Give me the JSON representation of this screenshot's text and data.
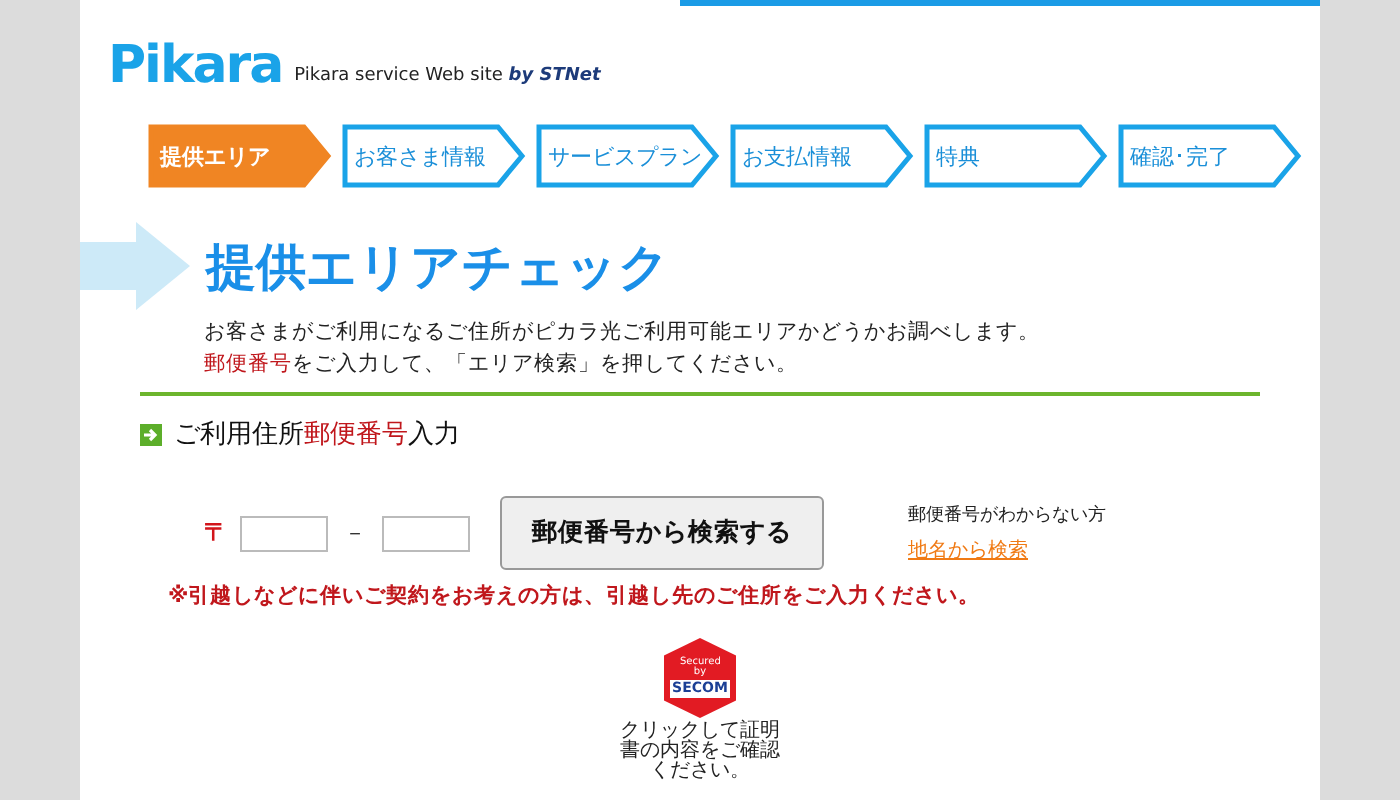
{
  "header": {
    "logo": "Pikara",
    "tagline": "Pikara service Web site",
    "by": "by STNet"
  },
  "steps": [
    {
      "label": "提供エリア",
      "selected": true
    },
    {
      "label": "お客さま情報",
      "selected": false
    },
    {
      "label": "サービスプラン",
      "selected": false
    },
    {
      "label": "お支払情報",
      "selected": false
    },
    {
      "label": "特典",
      "selected": false
    },
    {
      "label": "確認･完了",
      "selected": false
    }
  ],
  "title": "提供エリアチェック",
  "intro": [
    {
      "text": "お客さまがご利用になるご住所がピカラ光ご利用可能エリアかどうかお調べします。"
    },
    {
      "highlight": "郵便番号",
      "text": "をご入力して、「エリア検索」を押してください。"
    }
  ],
  "section": {
    "before": "ご利用住所",
    "highlight": "郵便番号",
    "after": "入力"
  },
  "postal": {
    "mark": "〒",
    "dash": "－",
    "button": "郵便番号から検索する",
    "hint": "郵便番号がわからない方",
    "link": "地名から検索"
  },
  "notice": "※引越しなどに伴いご契約をお考えの方は、引越し先のご住所をご入力ください。",
  "seal": {
    "top": "Secured by",
    "brand": "SECOM",
    "caption": "クリックして証明書の内容をご確認ください。"
  }
}
